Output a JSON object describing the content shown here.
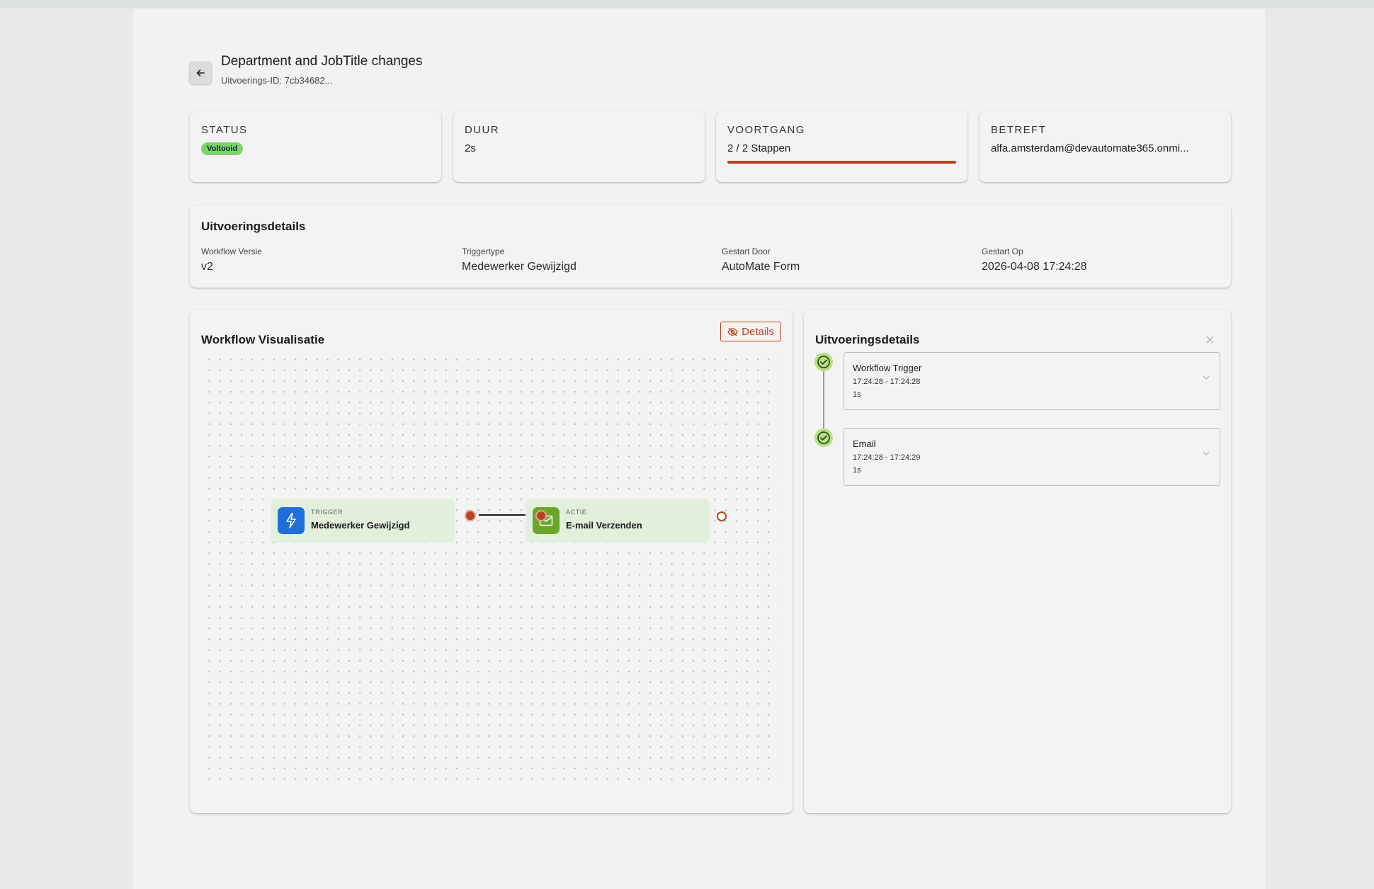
{
  "header": {
    "title": "Department and JobTitle changes",
    "execution_id": "Uitvoerings-ID: 7cb34682..."
  },
  "stats": {
    "status": {
      "label": "STATUS",
      "value": "Voltooid",
      "color": "#7dd36b"
    },
    "duration": {
      "label": "DUUR",
      "value": "2s"
    },
    "progress": {
      "label": "VOORTGANG",
      "value": "2 / 2 Stappen",
      "fraction": 1.0,
      "color": "#b8431f"
    },
    "subject": {
      "label": "BETREFT",
      "value": "alfa.amsterdam@devautomate365.onmi..."
    }
  },
  "execution_details": {
    "title": "Uitvoeringsdetails",
    "fields": [
      {
        "label": "Workflow Versie",
        "value": "v2"
      },
      {
        "label": "Triggertype",
        "value": "Medewerker Gewijzigd"
      },
      {
        "label": "Gestart Door",
        "value": "AutoMate Form"
      },
      {
        "label": "Gestart Op",
        "value": "2026-04-08 17:24:28"
      }
    ]
  },
  "visualization": {
    "title": "Workflow Visualisatie",
    "details_button": "Details",
    "nodes": [
      {
        "kicker": "TRIGGER",
        "name": "Medewerker Gewijzigd",
        "icon": "lightning-icon",
        "color": "#1e6fd9"
      },
      {
        "kicker": "ACTIE",
        "name": "E-mail Verzenden",
        "icon": "mail-icon",
        "color": "#6aa62a"
      }
    ]
  },
  "steps_panel": {
    "title": "Uitvoeringsdetails",
    "steps": [
      {
        "name": "Workflow Trigger",
        "time": "17:24:28 - 17:24:28",
        "duration": "1s"
      },
      {
        "name": "Email",
        "time": "17:24:28 - 17:24:29",
        "duration": "1s"
      }
    ]
  }
}
